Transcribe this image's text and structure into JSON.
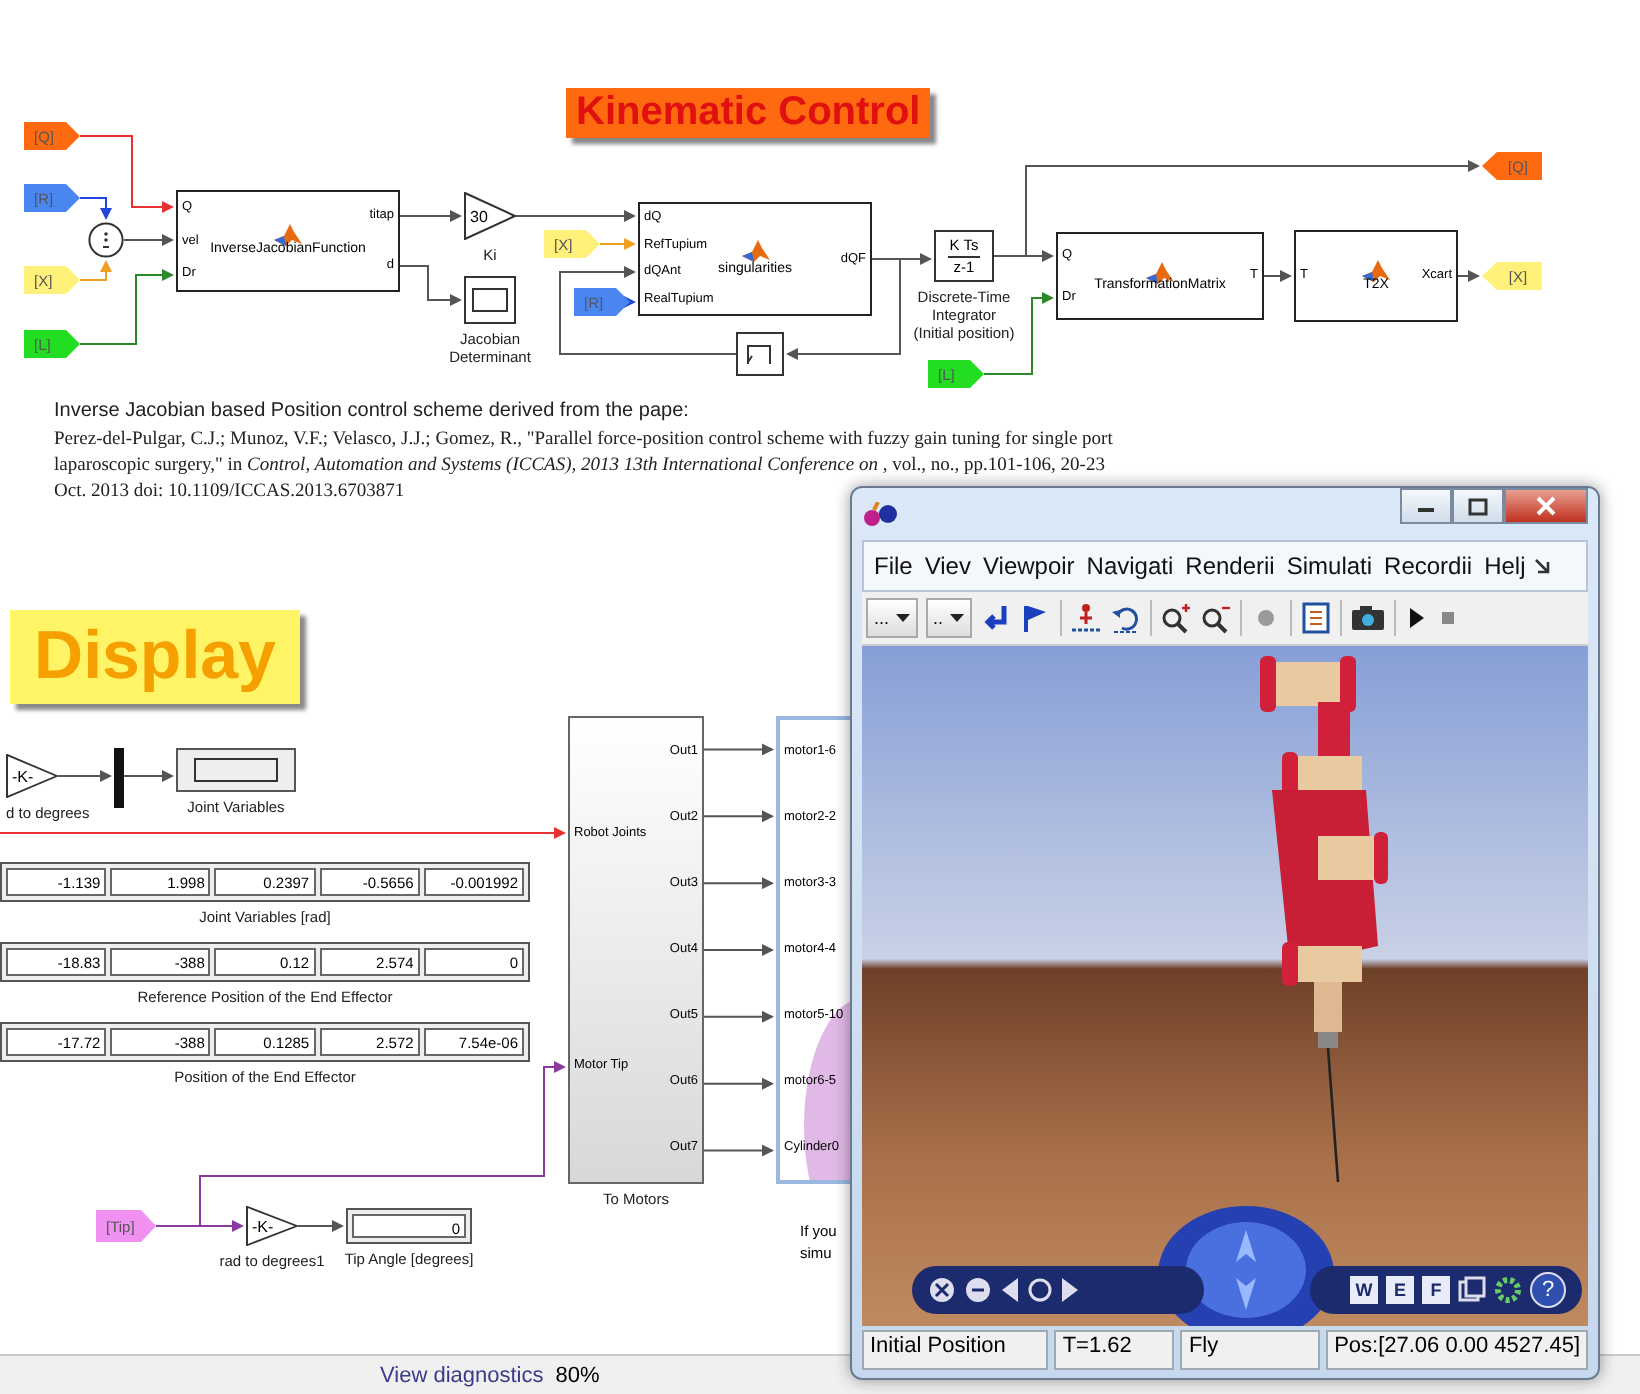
{
  "kinematic_title": "Kinematic Control",
  "citation": {
    "intro": "Inverse Jacobian based Position control scheme derived from the pape:",
    "reference": "Perez-del-Pulgar, C.J.; Munoz, V.F.; Velasco, J.J.; Gomez, R., \"Parallel force-position control scheme with fuzzy gain tuning for single port laparoscopic surgery,\" in *Control, Automation and Systems (ICCAS), 2013 13th International Conference on* , vol., no., pp.101-106, 20-23 Oct. 2013 doi: 10.1109/ICCAS.2013.6703871"
  },
  "display_title": "Display",
  "blocks": [
    {
      "kind": "from_tag",
      "label": "[Q]",
      "color": "#ff6a10"
    },
    {
      "kind": "from_tag",
      "label": "[R]",
      "color": "#4a86f0"
    },
    {
      "kind": "from_tag",
      "label": "[X]",
      "color": "#fff07a"
    },
    {
      "kind": "from_tag",
      "label": "[L]",
      "color": "#22dd22"
    },
    {
      "kind": "sum"
    },
    {
      "kind": "matlab_function",
      "name": "InverseJacobianFunction",
      "inputs": [
        "Q",
        "vel",
        "Dr"
      ],
      "outputs": [
        "titap",
        "d"
      ]
    },
    {
      "kind": "gain",
      "value": "30",
      "caption": "Ki"
    },
    {
      "kind": "scope",
      "caption": "Jacobian\nDeterminant"
    },
    {
      "kind": "from_tag",
      "label": "[X]",
      "color": "#fff07a"
    },
    {
      "kind": "from_tag",
      "label": "[R]",
      "color": "#4a86f0"
    },
    {
      "kind": "matlab_function",
      "name": "singularities",
      "inputs": [
        "dQ",
        "RefTupium",
        "dQAnt",
        "RealTupium"
      ],
      "outputs": [
        "dQF"
      ]
    },
    {
      "kind": "delay"
    },
    {
      "kind": "integrator",
      "numerator": "K Ts",
      "denominator": "z-1",
      "caption": "Discrete-Time\nIntegrator\n(Initial position)"
    },
    {
      "kind": "from_tag",
      "label": "[L]",
      "color": "#22dd22"
    },
    {
      "kind": "matlab_function",
      "name": "TransformationMatrix",
      "inputs": [
        "Q",
        "Dr"
      ],
      "outputs": [
        "T"
      ]
    },
    {
      "kind": "matlab_function",
      "name": "T2X",
      "inputs": [
        "T"
      ],
      "outputs": [
        "Xcart"
      ]
    },
    {
      "kind": "goto_tag",
      "label": "[Q]",
      "color": "#ff6a10"
    },
    {
      "kind": "goto_tag",
      "label": "[X]",
      "color": "#fff07a"
    },
    {
      "kind": "gain",
      "value": "-K-",
      "caption": "d to degrees"
    },
    {
      "kind": "mux"
    },
    {
      "kind": "display",
      "caption": "Joint Variables"
    },
    {
      "kind": "display",
      "values": [
        "-1.139",
        "1.998",
        "0.2397",
        "-0.5656",
        "-0.001992"
      ],
      "caption": "Joint Variables [rad]"
    },
    {
      "kind": "display",
      "values": [
        "-18.83",
        "-388",
        "0.12",
        "2.574",
        "0"
      ],
      "caption": "Reference Position of the End Effector"
    },
    {
      "kind": "display",
      "values": [
        "-17.72",
        "-388",
        "0.1285",
        "2.572",
        "7.54e-06"
      ],
      "caption": "Position of the End Effector"
    },
    {
      "kind": "subsystem",
      "inputs": [
        "Robot Joints",
        "Motor Tip"
      ],
      "outputs": [
        "Out1",
        "Out2",
        "Out3",
        "Out4",
        "Out5",
        "Out6",
        "Out7"
      ],
      "caption": "To Motors"
    },
    {
      "kind": "vr_sink",
      "inputs": [
        "motor1-6",
        "motor2-2",
        "motor3-3",
        "motor4-4",
        "motor5-10",
        "motor6-5",
        "Cylinder0"
      ]
    },
    {
      "kind": "from_tag",
      "label": "[Tip]",
      "color": "#f090f0"
    },
    {
      "kind": "gain",
      "value": "-K-",
      "caption": "rad to degrees1"
    },
    {
      "kind": "display",
      "values": [
        "0"
      ],
      "caption": "Tip Angle [degrees]"
    }
  ],
  "note_lines": [
    "If you",
    "simu"
  ],
  "viewer": {
    "menu": [
      "File",
      "Viev",
      "Viewpoir",
      "Navigati",
      "Renderii",
      "Simulati",
      "Recordii",
      "Helj"
    ],
    "dropdowns": [
      "...",
      ".."
    ],
    "nav_buttons": [
      "W",
      "E",
      "F"
    ],
    "help": "?",
    "status": [
      "Initial Position",
      "T=1.62",
      "Fly",
      "Pos:[27.06 0.00 4527.45]"
    ]
  },
  "status_bar": {
    "link": "View diagnostics",
    "zoom": "80%"
  }
}
